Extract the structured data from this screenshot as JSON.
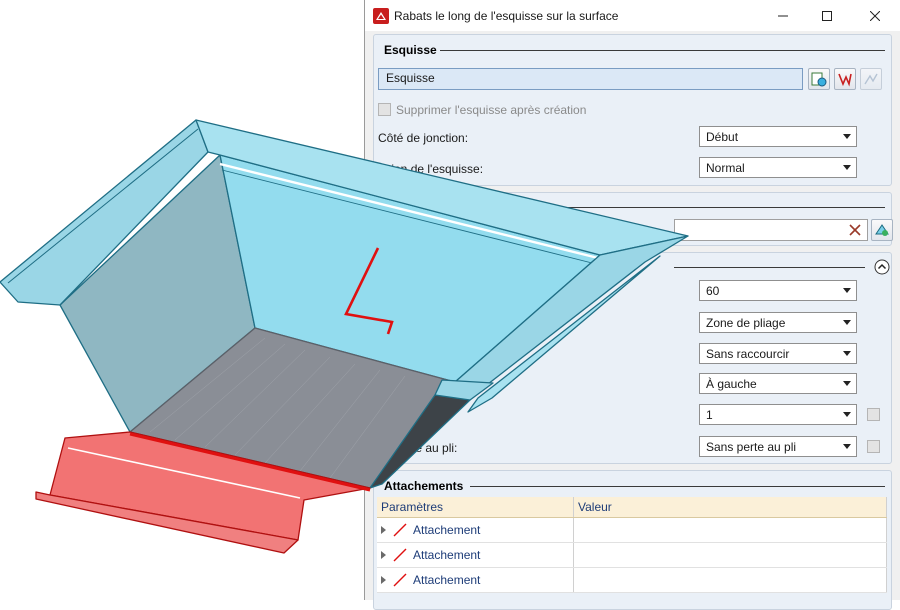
{
  "window": {
    "title": "Rabats le long de l'esquisse sur la surface"
  },
  "esquisse": {
    "heading": "Esquisse",
    "field_value": "Esquisse",
    "delete_checkbox_label": "Supprimer l'esquisse après création",
    "join_side_label": "Côté de jonction:",
    "join_side_value": "Début",
    "orientation_label": "tation de l'esquisse:",
    "orientation_value": "Normal"
  },
  "parameters": {
    "angle_value": "60",
    "bend_zone_value": "Zone de pliage",
    "shortening_value": "Sans raccourcir",
    "side_value": "À gauche",
    "count_value": "1",
    "bend_loss_label": "de perte au pli:",
    "bend_loss_value": "Sans perte au pli"
  },
  "attachments": {
    "heading": "Attachements",
    "col_params": "Paramètres",
    "col_value": "Valeur",
    "rows": [
      {
        "label": "Attachement",
        "value": ""
      },
      {
        "label": "Attachement",
        "value": ""
      },
      {
        "label": "Attachement",
        "value": ""
      }
    ]
  },
  "colors": {
    "model_blue": "#8ed8ea",
    "model_edge": "#1f6e85",
    "flange_red": "#f27373",
    "sketch_red": "#e01010",
    "panel_bg": "#eaf0f7"
  }
}
